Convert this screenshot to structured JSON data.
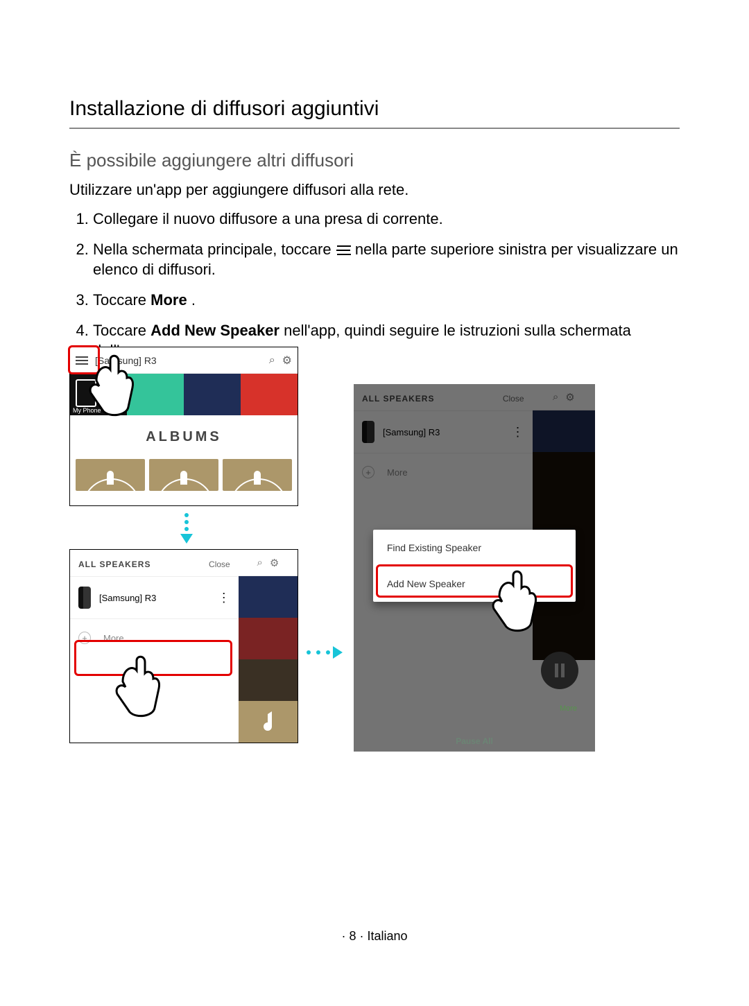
{
  "doc": {
    "title": "Installazione di diffusori aggiuntivi",
    "subtitle": "È possibile aggiungere altri diffusori",
    "intro": "Utilizzare un'app per aggiungere diffusori alla rete.",
    "step1": "Collegare il nuovo diffusore a una presa di corrente.",
    "step2_a": "Nella schermata principale, toccare ",
    "step2_b": " nella parte superiore sinistra per visualizzare un elenco di diffusori.",
    "step3_a": "Toccare ",
    "step3_bold": "More",
    "step3_b": ".",
    "step4_a": "Toccare ",
    "step4_bold": "Add New Speaker",
    "step4_b": " nell'app, quindi seguire le istruzioni sulla schermata dell'app."
  },
  "app": {
    "device": "[Samsung] R3",
    "tiles_phone_label": "My Phone",
    "albums_header": "ALBUMS",
    "drawer_title": "ALL SPEAKERS",
    "close": "Close",
    "more": "More",
    "popup_find": "Find Existing Speaker",
    "popup_add": "Add New Speaker",
    "pause_all": "Pause All"
  },
  "footer": {
    "text": "· 8 · Italiano"
  }
}
